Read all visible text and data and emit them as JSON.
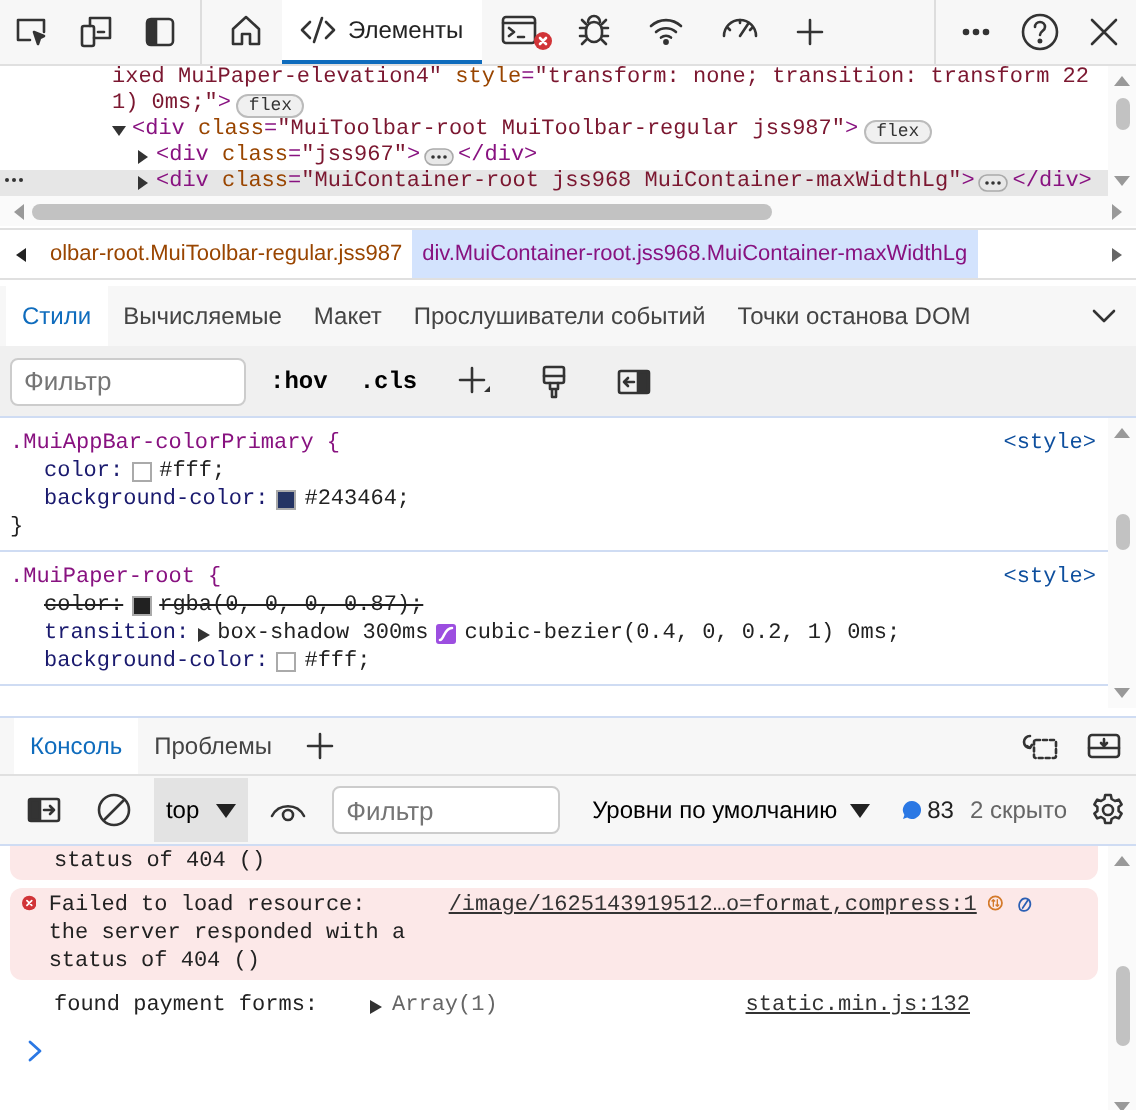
{
  "toolbar": {
    "tabs": [
      {
        "selected": false
      },
      {
        "label": "Элементы",
        "selected": true
      },
      {
        "selected": false,
        "error_badge": true
      },
      {
        "selected": false
      },
      {
        "selected": false
      },
      {
        "selected": false
      }
    ]
  },
  "dom_tree": {
    "lines": [
      {
        "kind": "tail",
        "selected": false,
        "tokens": [
          {
            "kind": "value",
            "text": "ixed MuiPaper-elevation4\""
          },
          {
            "kind": "attr",
            "text": " style"
          },
          {
            "kind": "tag",
            "text": "="
          },
          {
            "kind": "value",
            "text": "\"transform: none; transition: transform 22"
          }
        ]
      },
      {
        "kind": "tail",
        "selected": false,
        "badge": "flex",
        "tokens": [
          {
            "kind": "value",
            "text": "1) 0ms;\""
          },
          {
            "kind": "tag",
            "text": ">"
          }
        ]
      },
      {
        "kind": "element",
        "selected": false,
        "expanded": true,
        "badge": "flex",
        "tokens": [
          {
            "kind": "tag",
            "text": "<div"
          },
          {
            "kind": "attr",
            "text": " class"
          },
          {
            "kind": "tag",
            "text": "="
          },
          {
            "kind": "value",
            "text": "\"MuiToolbar-root MuiToolbar-regular jss987\""
          },
          {
            "kind": "tag",
            "text": ">"
          }
        ],
        "children": [
          {
            "kind": "element",
            "selected": false,
            "expanded": false,
            "closing": "</div>",
            "tokens": [
              {
                "kind": "tag",
                "text": "<div"
              },
              {
                "kind": "attr",
                "text": " class"
              },
              {
                "kind": "tag",
                "text": "="
              },
              {
                "kind": "value",
                "text": "\"jss967\""
              },
              {
                "kind": "tag",
                "text": ">"
              }
            ]
          },
          {
            "kind": "element",
            "selected": true,
            "expanded": false,
            "closing": "</div>",
            "tokens": [
              {
                "kind": "tag",
                "text": "<div"
              },
              {
                "kind": "attr",
                "text": " class"
              },
              {
                "kind": "tag",
                "text": "="
              },
              {
                "kind": "value",
                "text": "\"MuiContainer-root jss968 MuiContainer-maxWidthLg\""
              },
              {
                "kind": "tag",
                "text": ">"
              }
            ]
          }
        ]
      }
    ]
  },
  "breadcrumbs": [
    {
      "label": "olbar-root.MuiToolbar-regular.jss987",
      "selected": false
    },
    {
      "label": "div.MuiContainer-root.jss968.MuiContainer-maxWidthLg",
      "selected": true
    }
  ],
  "styles_tabs": [
    {
      "label": "Стили",
      "selected": true
    },
    {
      "label": "Вычисляемые",
      "selected": false
    },
    {
      "label": "Макет",
      "selected": false
    },
    {
      "label": "Прослушиватели событий",
      "selected": false
    },
    {
      "label": "Точки останова DOM",
      "selected": false
    }
  ],
  "styles_toolbar": {
    "filter": {
      "placeholder": "Фильтр"
    },
    "hov": ":hov",
    "cls": ".cls"
  },
  "rules": [
    {
      "selector": ".MuiAppBar-colorPrimary {",
      "source": "<style>",
      "close": "}",
      "declarations": [
        {
          "property": "color:",
          "value": "#fff;",
          "color": "#ffffff",
          "overridden": false
        },
        {
          "property": "background-color:",
          "value": "#243464;",
          "color": "#243464",
          "overridden": false
        }
      ]
    },
    {
      "selector": ".MuiPaper-root {",
      "source": "<style>",
      "declarations": [
        {
          "property": "color:",
          "value": "rgba(0, 0, 0, 0.87);",
          "color": "#212121",
          "overridden": true
        },
        {
          "property": "transition:",
          "value": "box-shadow 300ms",
          "easing": "cubic-bezier(0.4, 0, 0.2, 1) 0ms;",
          "expandable": true,
          "overridden": false
        },
        {
          "property": "background-color:",
          "value": "#fff;",
          "color": "#ffffff",
          "overridden": false
        }
      ]
    }
  ],
  "drawer_tabs": [
    {
      "label": "Консоль",
      "selected": true
    },
    {
      "label": "Проблемы",
      "selected": false
    }
  ],
  "console_toolbar": {
    "context": "top",
    "filter": {
      "placeholder": "Фильтр"
    },
    "levels": "Уровни по умолчанию",
    "messages_count": "83",
    "hidden": "2 скрыто"
  },
  "messages": [
    {
      "kind": "error",
      "partial": true,
      "text": "status of 404 ()"
    },
    {
      "kind": "error",
      "text": "Failed to load resource:\nthe server responded with a\nstatus of 404 ()",
      "link": "/image/1625143919512…o=format,compress:1"
    },
    {
      "kind": "log",
      "text": "found payment forms:",
      "object": "Array(1)",
      "link": "static.min.js:132"
    }
  ]
}
